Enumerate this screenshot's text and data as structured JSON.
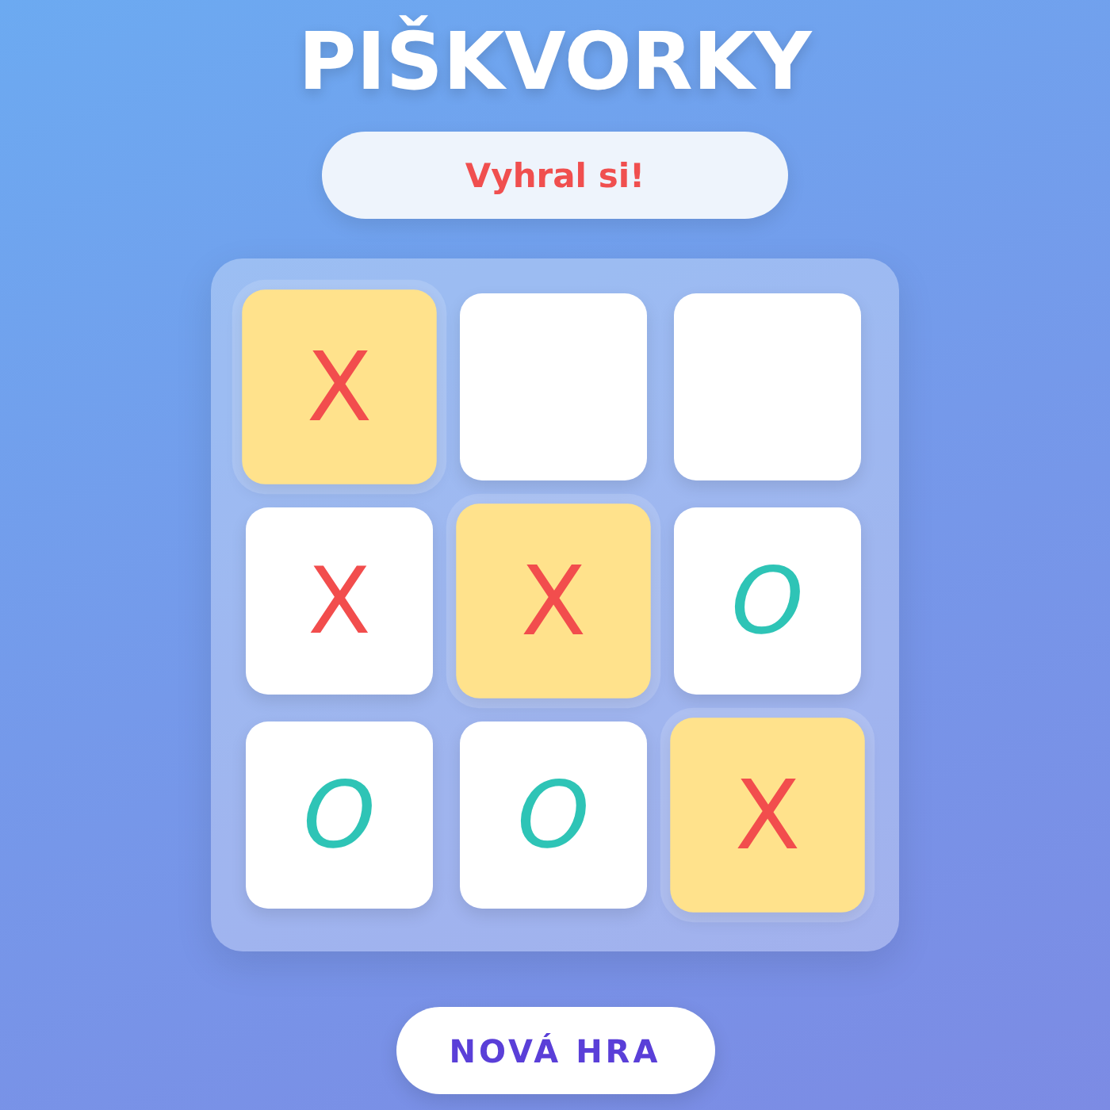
{
  "title": "PIŠKVORKY",
  "status": "Vyhral si!",
  "board": {
    "cells": [
      {
        "kind": "x",
        "mark": "X",
        "winning": true
      },
      {
        "kind": "empty",
        "winning": false
      },
      {
        "kind": "empty",
        "winning": false
      },
      {
        "kind": "x",
        "mark": "X",
        "winning": false
      },
      {
        "kind": "x",
        "mark": "X",
        "winning": true
      },
      {
        "kind": "o",
        "mark": "O",
        "winning": false
      },
      {
        "kind": "o",
        "mark": "O",
        "winning": false
      },
      {
        "kind": "o",
        "mark": "O",
        "winning": false
      },
      {
        "kind": "x",
        "mark": "X",
        "winning": true
      }
    ]
  },
  "new_game_button": "NOVÁ HRA"
}
